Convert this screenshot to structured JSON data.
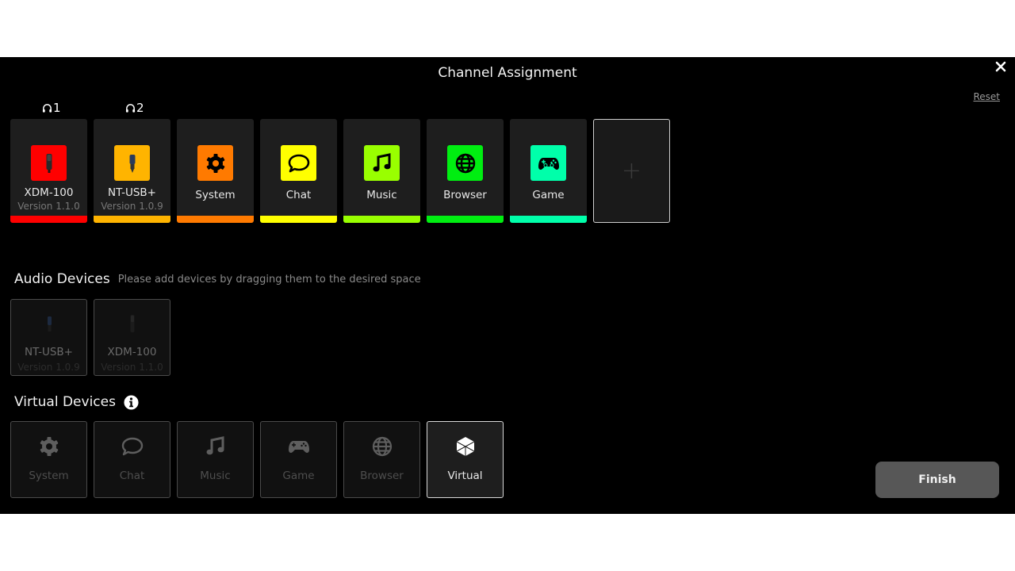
{
  "header": {
    "title": "Channel Assignment",
    "close_icon": "close-icon",
    "reset_label": "Reset"
  },
  "headphone_labels": [
    {
      "icon": "headphones-icon",
      "number": "1"
    },
    {
      "icon": "headphones-icon",
      "number": "2"
    }
  ],
  "channels": [
    {
      "name": "XDM-100",
      "version": "Version 1.1.0",
      "icon": "microphone-icon",
      "color": "#ff0000"
    },
    {
      "name": "NT-USB+",
      "version": "Version 1.0.9",
      "icon": "usb-microphone-icon",
      "color": "#ffb400"
    },
    {
      "name": "System",
      "icon": "gear-icon",
      "color": "#ff7a00"
    },
    {
      "name": "Chat",
      "icon": "chat-bubble-icon",
      "color": "#ffff00"
    },
    {
      "name": "Music",
      "icon": "music-note-icon",
      "color": "#99ff00"
    },
    {
      "name": "Browser",
      "icon": "globe-icon",
      "color": "#00ee11"
    },
    {
      "name": "Game",
      "icon": "gamepad-icon",
      "color": "#00ffaa"
    }
  ],
  "add_slot": {
    "label": "+",
    "icon": "plus-icon"
  },
  "audio_devices": {
    "title": "Audio Devices",
    "hint": "Please add devices by dragging them to the desired space",
    "items": [
      {
        "name": "NT-USB+",
        "version": "Version 1.0.9",
        "icon": "usb-microphone-icon"
      },
      {
        "name": "XDM-100",
        "version": "Version 1.1.0",
        "icon": "microphone-icon"
      }
    ]
  },
  "virtual_devices": {
    "title": "Virtual Devices",
    "info_icon": "info-icon",
    "items": [
      {
        "name": "System",
        "icon": "gear-icon",
        "active": false
      },
      {
        "name": "Chat",
        "icon": "chat-bubble-icon",
        "active": false
      },
      {
        "name": "Music",
        "icon": "music-note-icon",
        "active": false
      },
      {
        "name": "Game",
        "icon": "gamepad-icon",
        "active": false
      },
      {
        "name": "Browser",
        "icon": "globe-icon",
        "active": false
      },
      {
        "name": "Virtual",
        "icon": "cube-icon",
        "active": true
      }
    ]
  },
  "footer": {
    "finish_label": "Finish"
  }
}
